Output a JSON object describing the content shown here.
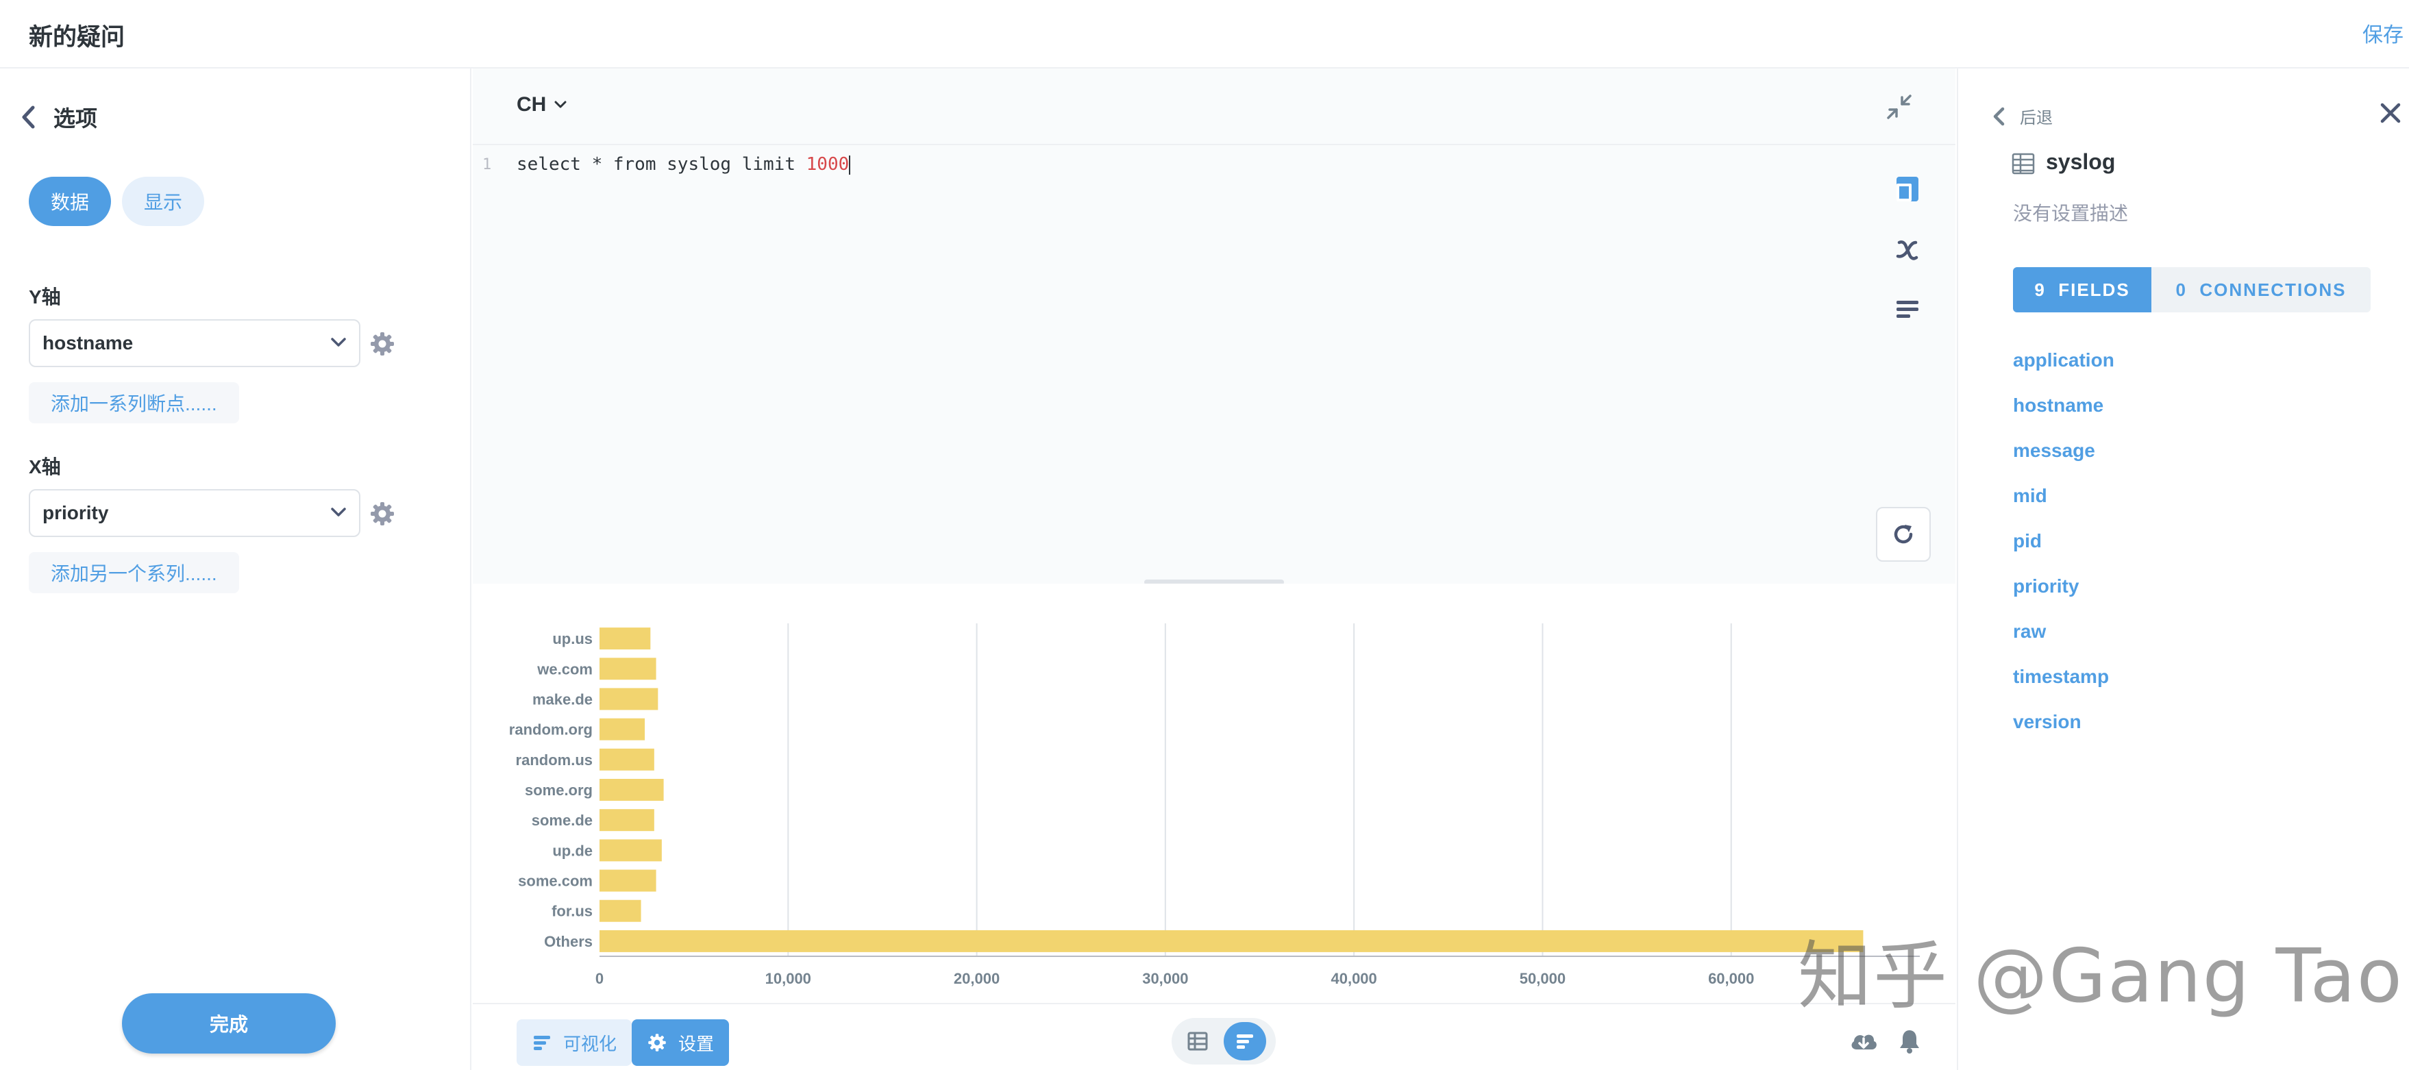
{
  "header": {
    "title": "新的疑问",
    "save_label": "保存"
  },
  "left_sidebar": {
    "back_label": "选项",
    "tabs": [
      {
        "label": "数据",
        "active": true
      },
      {
        "label": "显示",
        "active": false
      }
    ],
    "y_axis": {
      "label": "Y轴",
      "value": "hostname",
      "add_label": "添加一系列断点......"
    },
    "x_axis": {
      "label": "X轴",
      "value": "priority",
      "add_label": "添加另一个系列......"
    },
    "done_label": "完成"
  },
  "editor": {
    "database": "CH",
    "line_number": "1",
    "sql_text": "select * from syslog limit ",
    "sql_number": "1000"
  },
  "chart_data": {
    "type": "bar",
    "orientation": "horizontal",
    "categories": [
      "up.us",
      "we.com",
      "make.de",
      "random.org",
      "random.us",
      "some.org",
      "some.de",
      "up.de",
      "some.com",
      "for.us",
      "Others"
    ],
    "values": [
      2700,
      3000,
      3100,
      2400,
      2900,
      3400,
      2900,
      3300,
      3000,
      2200,
      67000
    ],
    "x_ticks": [
      "0",
      "10,000",
      "20,000",
      "30,000",
      "40,000",
      "50,000",
      "60,000"
    ],
    "xlim": [
      0,
      70000
    ],
    "grid": true,
    "bar_color": "#f2d46f",
    "title": "",
    "xlabel": "",
    "ylabel": ""
  },
  "footer": {
    "viz_label": "可视化",
    "settings_label": "设置"
  },
  "right_panel": {
    "back_label": "后退",
    "table_name": "syslog",
    "description": "没有设置描述",
    "tab_fields": "9  FIELDS",
    "tab_connections": "0  CONNECTIONS",
    "fields": [
      "application",
      "hostname",
      "message",
      "mid",
      "pid",
      "priority",
      "raw",
      "timestamp",
      "version"
    ]
  },
  "watermark": "知乎 @Gang Tao",
  "colors": {
    "accent": "#509ee3",
    "bar": "#f2d46f",
    "text": "#2e353b",
    "muted": "#949aab"
  }
}
